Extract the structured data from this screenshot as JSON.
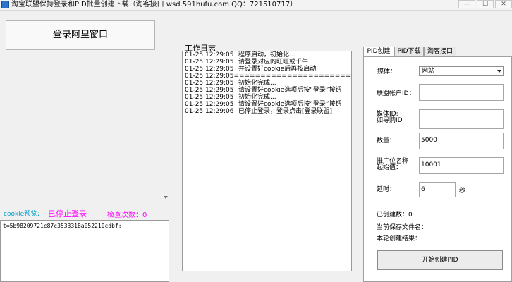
{
  "window": {
    "title": "淘宝联盟保持登录和PID批量创建下载（淘客接口 wsd.591hufu.com  QQ：721510717）",
    "controls": [
      "—",
      "☐",
      "✕"
    ]
  },
  "login": {
    "button_label": "登录阿里窗口"
  },
  "cookie": {
    "preview_label": "cookie预览：",
    "status": "已停止登录",
    "check_count_label": "检查次数：0",
    "value": "t=5b98209721c87c3533318a052210cdbf;"
  },
  "log": {
    "label": "工作日志",
    "rows": [
      {
        "time": "01-25 12:29:05",
        "msg": "程序启动，初始化..."
      },
      {
        "time": "01-25 12:29:05",
        "msg": "请登录对应的旺旺或千牛"
      },
      {
        "time": "01-25 12:29:05",
        "msg": "并设置好cookie后再按启动"
      },
      {
        "time": "01-25 12:29:05",
        "msg": "=========================="
      },
      {
        "time": "01-25 12:29:05",
        "msg": "初始化完成..."
      },
      {
        "time": "01-25 12:29:05",
        "msg": "请设置好cookie选项后按“登录”按钮"
      },
      {
        "time": "01-25 12:29:05",
        "msg": "初始化完成..."
      },
      {
        "time": "01-25 12:29:05",
        "msg": "请设置好cookie选项后按“登录”按钮"
      },
      {
        "time": "01-25 12:29:06",
        "msg": "已停止登录，登录点击[登录联盟]"
      }
    ]
  },
  "tabs": {
    "items": [
      "PID创建",
      "PID下载",
      "淘客接口"
    ],
    "active": "PID创建"
  },
  "pid_form": {
    "media_label": "媒体：",
    "media_value": "网站",
    "account_label": "联盟帐户ID：",
    "account_value": "",
    "media_id_label_1": "媒体ID:",
    "media_id_label_2": "如导购ID",
    "media_id_value": "",
    "count_label": "数量：",
    "count_value": "5000",
    "start_label_1": "推广位名称",
    "start_label_2": "起始值：",
    "start_value": "10001",
    "delay_label": "延时：",
    "delay_value": "6",
    "delay_unit": "秒",
    "created_label": "已创建数：0",
    "file_label": "当前保存文件名：",
    "result_label": "本轮创建结果：",
    "start_button": "开始创建PID"
  }
}
